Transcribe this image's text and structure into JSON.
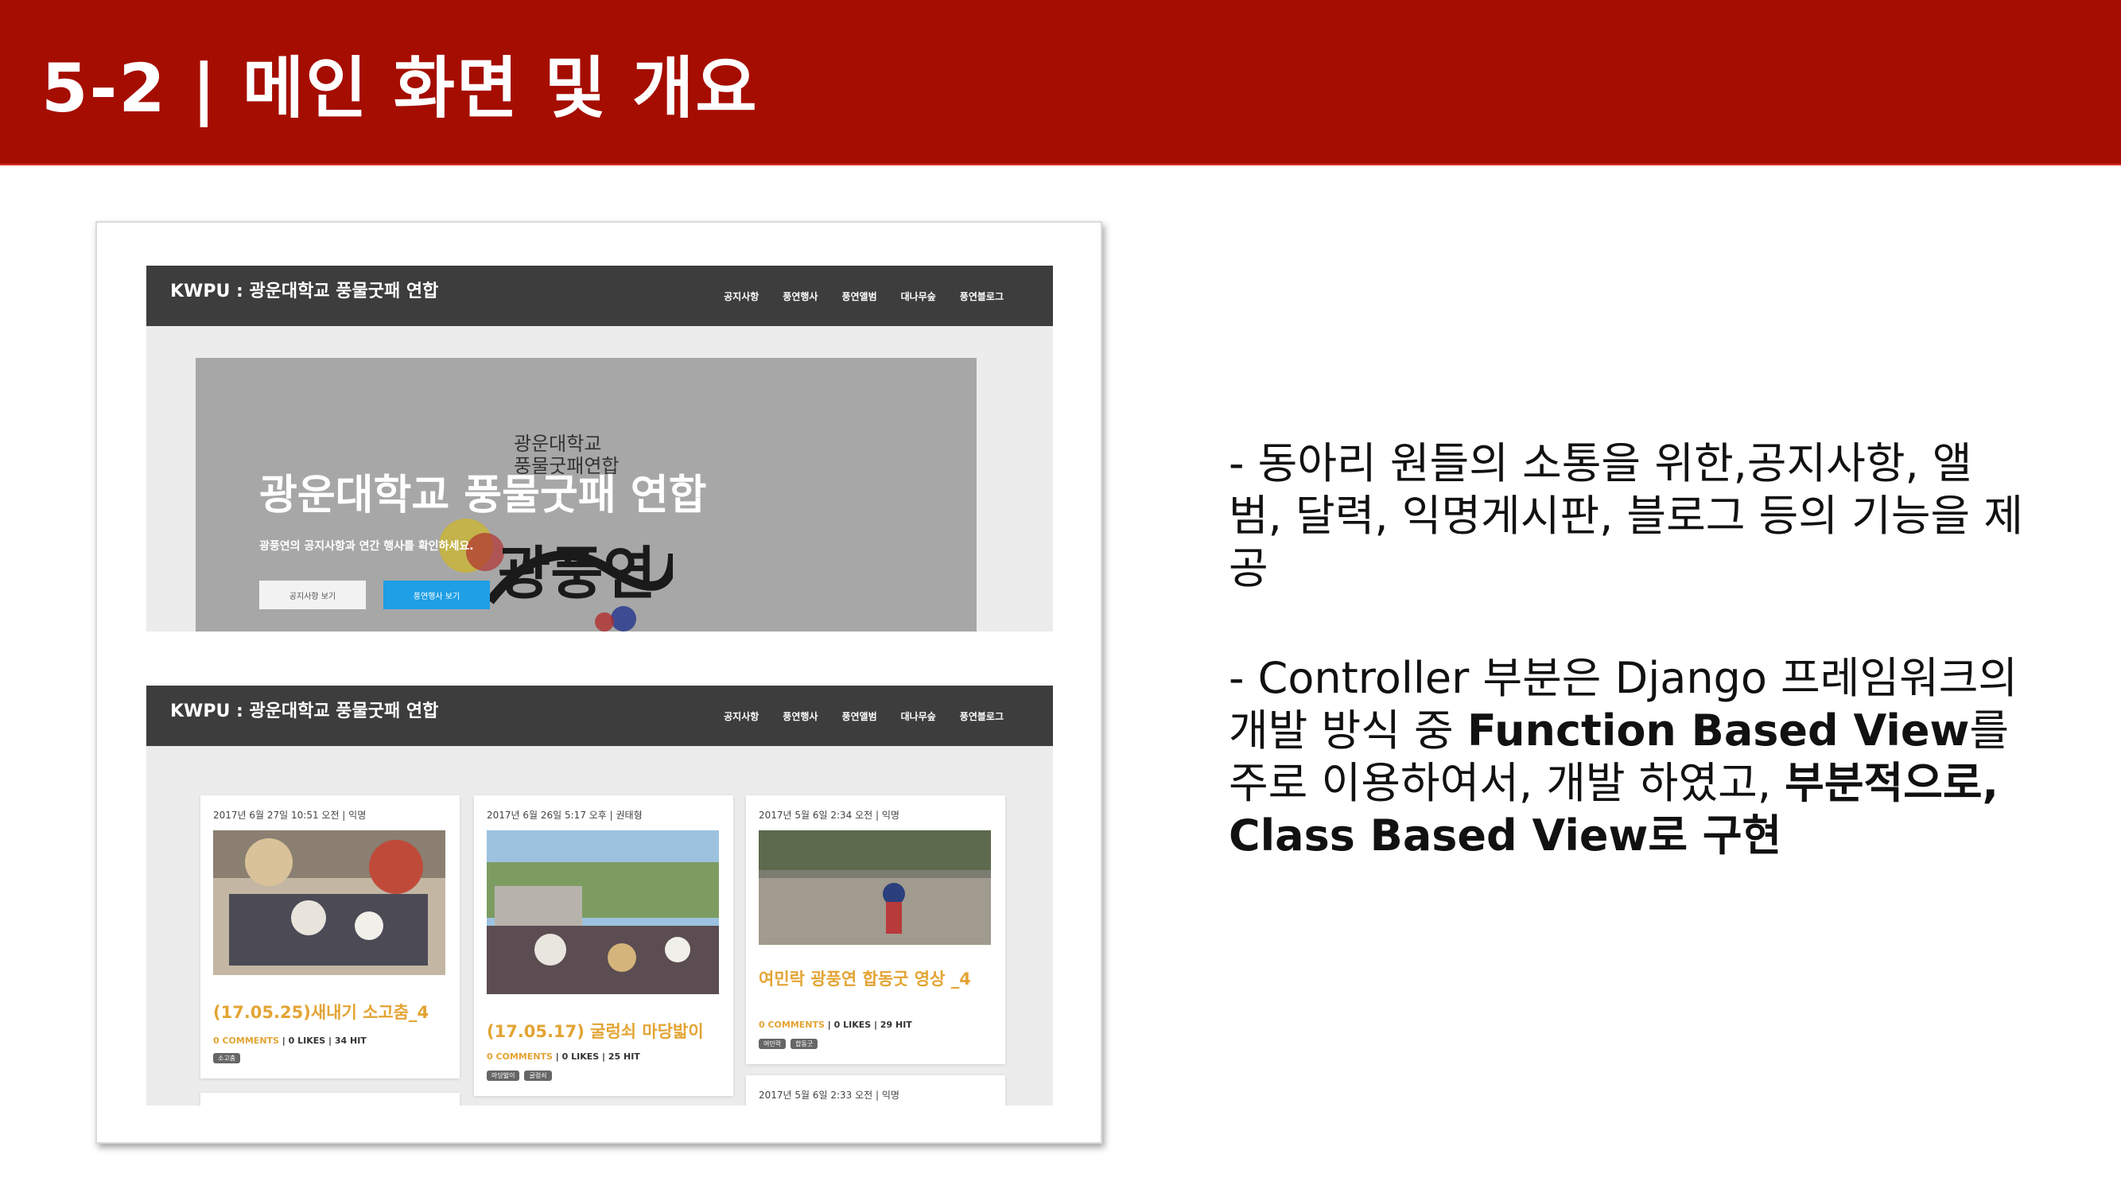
{
  "slide": {
    "title": "5-2 | 메인 화면 및 개요"
  },
  "site": {
    "brand": "KWPU : 광운대학교 풍물굿패 연합",
    "menu": [
      "공지사항",
      "풍연행사",
      "풍연앨범",
      "대나무숲",
      "풍연블로그"
    ],
    "hero": {
      "title": "광운대학교 풍물굿패 연합",
      "subtitle": "광풍연의 공지사항과 연간 행사를 확인하세요.",
      "btn_notice": "공지사항 보기",
      "btn_events": "풍연행사 보기",
      "logo_line1": "광운대학교",
      "logo_line2": "풍물굿패연합",
      "logo_main": "광풍연"
    },
    "posts": [
      {
        "meta": "2017년 6월 27일 10:51 오전 | 익명",
        "title": "(17.05.25)새내기 소고춤_4",
        "comments": "0 COMMENTS",
        "stats": "| 0 LIKES | 34 HIT",
        "tags": [
          "소고춤"
        ]
      },
      {
        "meta": "2017년 6월 26일 5:17 오후 | 권태형",
        "title": "(17.05.17) 굴렁쇠 마당밟이",
        "comments": "0 COMMENTS",
        "stats": "| 0 LIKES | 25 HIT",
        "tags": [
          "마당밟이",
          "굴렁쇠"
        ]
      },
      {
        "meta": "2017년 5월 6일 2:34 오전 | 익명",
        "title": "여민락 광풍연 합동굿 영상 _4",
        "comments": "0 COMMENTS",
        "stats": "| 0 LIKES | 29 HIT",
        "tags": [
          "여민락",
          "합동굿"
        ]
      },
      {
        "meta": "2017년 5월 6일 2:33 오전 | 익명"
      }
    ]
  },
  "description": {
    "p1": "- 동아리 원들의 소통을 위한,공지사항, 앨범, 달력, 익명게시판, 블로그 등의 기능을 제공",
    "p2_a": "- Controller 부분은 Django 프레임워크의 개발 방식 중 ",
    "p2_b": "Function Based View",
    "p2_c": "를 주로 이용하여서, 개발 하였고, ",
    "p2_d": "부분적으로, Class Based View로 구현"
  }
}
